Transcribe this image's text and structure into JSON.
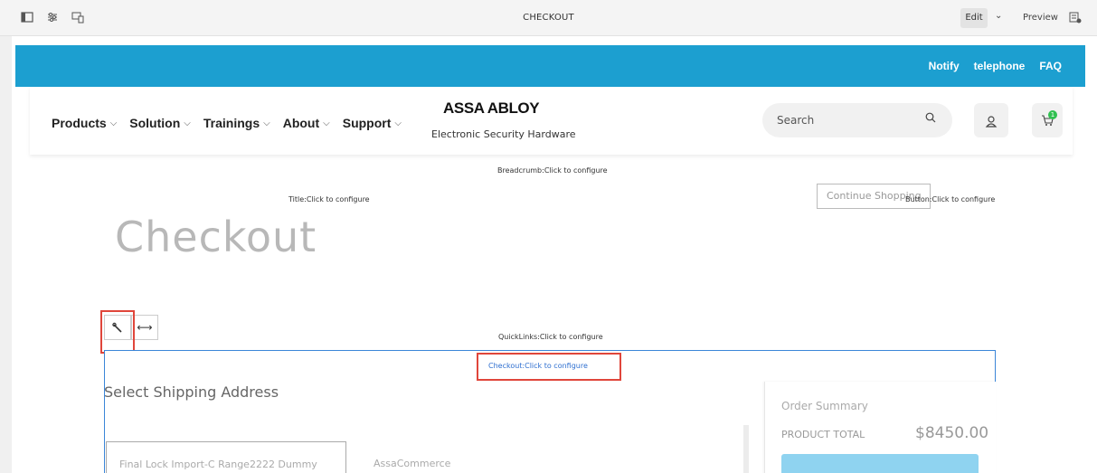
{
  "editor_bar": {
    "title": "CHECKOUT",
    "edit_label": "Edit",
    "preview_label": "Preview",
    "icons": [
      "side-panel-icon",
      "properties-icon",
      "emulator-icon",
      "chevron-down-icon",
      "page-settings-icon"
    ]
  },
  "topbar": {
    "links": [
      "Notify",
      "telephone",
      "FAQ"
    ]
  },
  "header": {
    "nav": [
      "Products",
      "Solution",
      "Trainings",
      "About",
      "Support"
    ],
    "logo": "ASSA ABLOY",
    "logo_sub": "Electronic Security Hardware",
    "search_placeholder": "Search",
    "cart_count": "1"
  },
  "placeholders": {
    "breadcrumb": "Breadcrumb:Click to configure",
    "title": "Title:Click to configure",
    "button": "Button:Click to configure",
    "quicklinks": "QuickLinks:Click to configure",
    "checkout": "Checkout:Click to configure"
  },
  "page": {
    "continue_button": "Continue Shopping",
    "title": "Checkout"
  },
  "checkout": {
    "shipping_title": "Select Shipping Address",
    "address_text": "Final Lock Import-C Range2222 Dummy",
    "address_brand": "AssaCommerce",
    "summary_title": "Order Summary",
    "product_total_label": "PRODUCT TOTAL",
    "product_total_value": "$8450.00"
  },
  "colors": {
    "topbar": "#1c9fd0",
    "highlight": "#e0463b",
    "component_border": "#3b86d8"
  }
}
